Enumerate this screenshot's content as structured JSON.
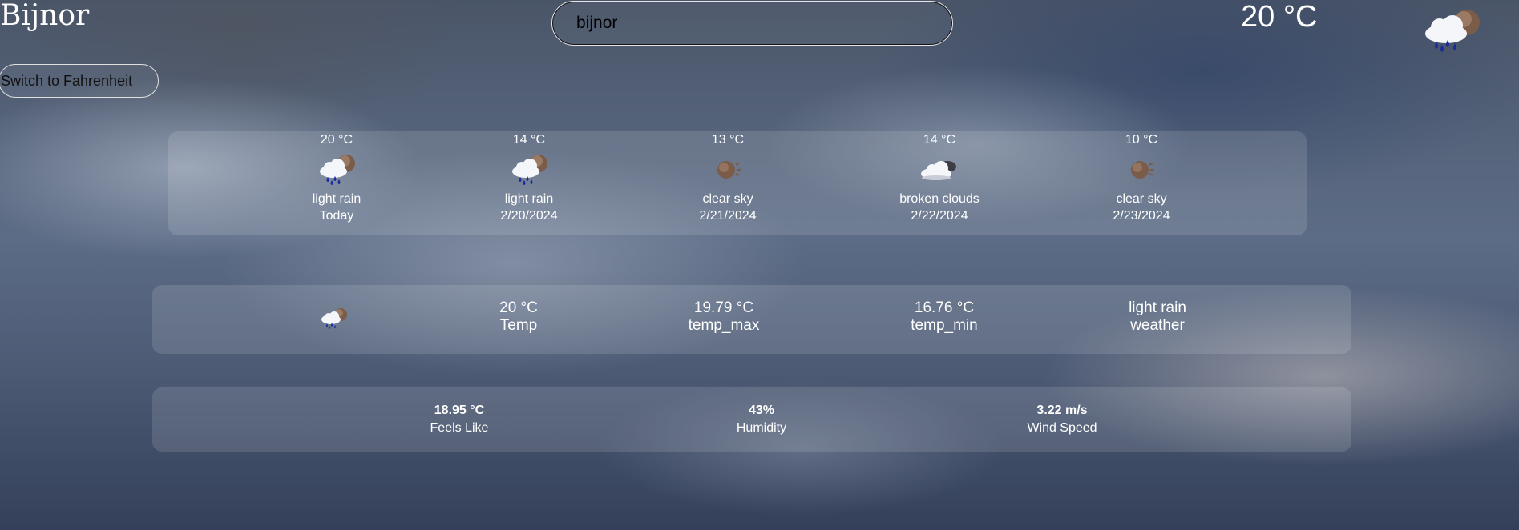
{
  "header": {
    "city": "Bijnor",
    "unit_toggle_label": "Switch to Fahrenheit",
    "search": {
      "value": "bijnor",
      "placeholder": ""
    },
    "current_temp": "20 °C",
    "current_icon": "rain-cloud-icon"
  },
  "forecast": [
    {
      "temp": "20 °C",
      "description": "light rain",
      "date": "Today",
      "icon": "rain-cloud-icon"
    },
    {
      "temp": "14 °C",
      "description": "light rain",
      "date": "2/20/2024",
      "icon": "rain-cloud-icon"
    },
    {
      "temp": "13 °C",
      "description": "clear sky",
      "date": "2/21/2024",
      "icon": "moon-icon"
    },
    {
      "temp": "14 °C",
      "description": "broken clouds",
      "date": "2/22/2024",
      "icon": "cloud-moon-icon"
    },
    {
      "temp": "10 °C",
      "description": "clear sky",
      "date": "2/23/2024",
      "icon": "moon-icon"
    }
  ],
  "current": {
    "icon": "rain-cloud-icon",
    "items": [
      {
        "value": "20 °C",
        "label": "Temp"
      },
      {
        "value": "19.79 °C",
        "label": "temp_max"
      },
      {
        "value": "16.76 °C",
        "label": "temp_min"
      },
      {
        "value": "light rain",
        "label": "weather"
      }
    ]
  },
  "details": [
    {
      "value": "18.95 °C",
      "label": "Feels Like"
    },
    {
      "value": "43%",
      "label": "Humidity"
    },
    {
      "value": "3.22 m/s",
      "label": "Wind Speed"
    }
  ],
  "colors": {
    "rain_drop": "#1c2b9a",
    "moon": "#7a5c48",
    "cloud": "#f4f6fa"
  }
}
